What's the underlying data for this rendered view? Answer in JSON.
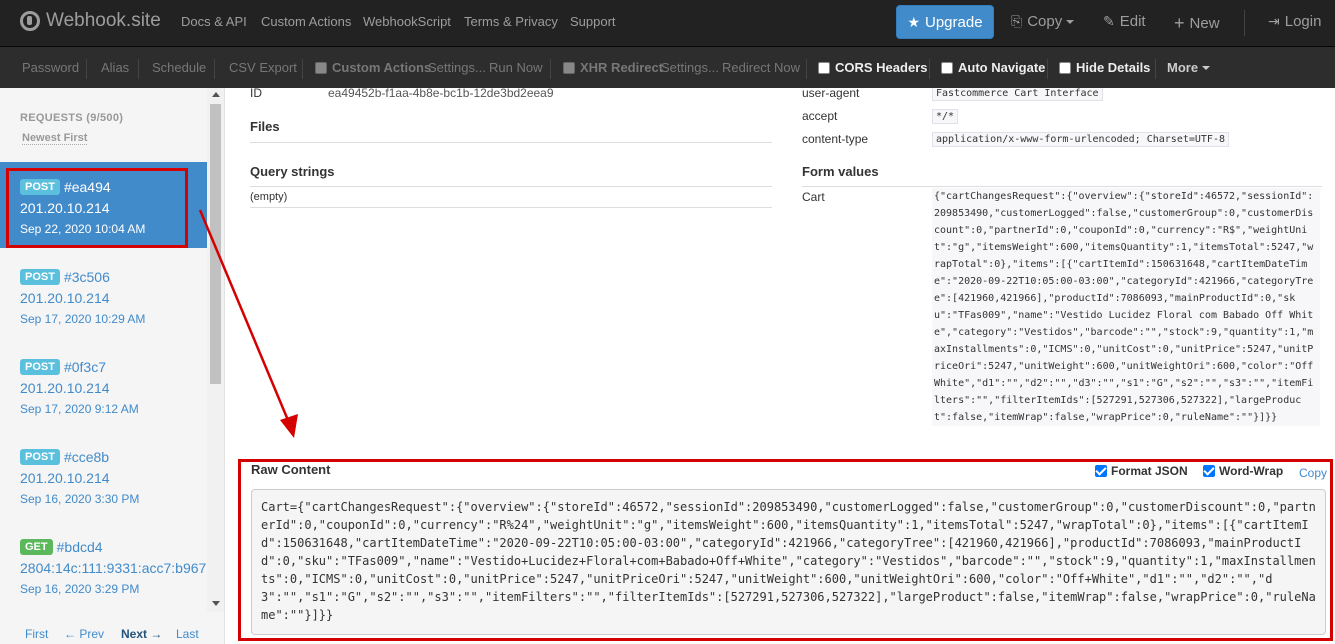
{
  "navbar": {
    "brand": "Webhook.site",
    "links": [
      "Docs & API",
      "Custom Actions",
      "WebhookScript",
      "Terms & Privacy",
      "Support"
    ],
    "upgrade": "Upgrade",
    "copy": "Copy",
    "edit": "Edit",
    "new": "New",
    "login": "Login"
  },
  "toolbar": {
    "password": "Password",
    "alias": "Alias",
    "schedule": "Schedule",
    "csv_export": "CSV Export",
    "custom_actions": "Custom Actions",
    "settings1": "Settings...",
    "run_now": "Run Now",
    "xhr_redirect": "XHR Redirect",
    "settings2": "Settings...",
    "redirect_now": "Redirect Now",
    "cors_headers": "CORS Headers",
    "auto_navigate": "Auto Navigate",
    "hide_details": "Hide Details",
    "more": "More"
  },
  "sidebar": {
    "header": "REQUESTS (9/500)",
    "sort": "Newest First",
    "items": [
      {
        "method": "POST",
        "id": "#ea494",
        "ip": "201.20.10.214",
        "date": "Sep 22, 2020 10:04 AM"
      },
      {
        "method": "POST",
        "id": "#3c506",
        "ip": "201.20.10.214",
        "date": "Sep 17, 2020 10:29 AM"
      },
      {
        "method": "POST",
        "id": "#0f3c7",
        "ip": "201.20.10.214",
        "date": "Sep 17, 2020 9:12 AM"
      },
      {
        "method": "POST",
        "id": "#cce8b",
        "ip": "201.20.10.214",
        "date": "Sep 16, 2020 3:30 PM"
      },
      {
        "method": "GET",
        "id": "#bdcd4",
        "ip": "2804:14c:111:9331:acc7:b967",
        "date": "Sep 16, 2020 3:29 PM"
      }
    ],
    "pager": {
      "first": "First",
      "prev": "← Prev",
      "next": "Next →",
      "last": "Last"
    }
  },
  "details": {
    "id_label": "ID",
    "id_value": "ea49452b-f1aa-4b8e-bc1b-12de3bd2eea9",
    "files_title": "Files",
    "query_title": "Query strings",
    "query_empty": "(empty)"
  },
  "headers": [
    {
      "key": "user-agent",
      "value": "Fastcommerce Cart Interface"
    },
    {
      "key": "accept",
      "value": "*/*"
    },
    {
      "key": "content-type",
      "value": "application/x-www-form-urlencoded; Charset=UTF-8"
    }
  ],
  "form": {
    "title": "Form values",
    "key": "Cart",
    "value": "{\"cartChangesRequest\":{\"overview\":{\"storeId\":46572,\"sessionId\":209853490,\"customerLogged\":false,\"customerGroup\":0,\"customerDiscount\":0,\"partnerId\":0,\"couponId\":0,\"currency\":\"R$\",\"weightUnit\":\"g\",\"itemsWeight\":600,\"itemsQuantity\":1,\"itemsTotal\":5247,\"wrapTotal\":0},\"items\":[{\"cartItemId\":150631648,\"cartItemDateTime\":\"2020-09-22T10:05:00-03:00\",\"categoryId\":421966,\"categoryTree\":[421960,421966],\"productId\":7086093,\"mainProductId\":0,\"sku\":\"TFas009\",\"name\":\"Vestido Lucidez Floral com Babado Off White\",\"category\":\"Vestidos\",\"barcode\":\"\",\"stock\":9,\"quantity\":1,\"maxInstallments\":0,\"ICMS\":0,\"unitCost\":0,\"unitPrice\":5247,\"unitPriceOri\":5247,\"unitWeight\":600,\"unitWeightOri\":600,\"color\":\"Off White\",\"d1\":\"\",\"d2\":\"\",\"d3\":\"\",\"s1\":\"G\",\"s2\":\"\",\"s3\":\"\",\"itemFilters\":\"\",\"filterItemIds\":[527291,527306,527322],\"largeProduct\":false,\"itemWrap\":false,\"wrapPrice\":0,\"ruleName\":\"\"}]}}"
  },
  "raw": {
    "title": "Raw Content",
    "format_json": "Format JSON",
    "word_wrap": "Word-Wrap",
    "copy": "Copy",
    "content": "Cart={\"cartChangesRequest\":{\"overview\":{\"storeId\":46572,\"sessionId\":209853490,\"customerLogged\":false,\"customerGroup\":0,\"customerDiscount\":0,\"partnerId\":0,\"couponId\":0,\"currency\":\"R%24\",\"weightUnit\":\"g\",\"itemsWeight\":600,\"itemsQuantity\":1,\"itemsTotal\":5247,\"wrapTotal\":0},\"items\":[{\"cartItemId\":150631648,\"cartItemDateTime\":\"2020-09-22T10:05:00-03:00\",\"categoryId\":421966,\"categoryTree\":[421960,421966],\"productId\":7086093,\"mainProductId\":0,\"sku\":\"TFas009\",\"name\":\"Vestido+Lucidez+Floral+com+Babado+Off+White\",\"category\":\"Vestidos\",\"barcode\":\"\",\"stock\":9,\"quantity\":1,\"maxInstallments\":0,\"ICMS\":0,\"unitCost\":0,\"unitPrice\":5247,\"unitPriceOri\":5247,\"unitWeight\":600,\"unitWeightOri\":600,\"color\":\"Off+White\",\"d1\":\"\",\"d2\":\"\",\"d3\":\"\",\"s1\":\"G\",\"s2\":\"\",\"s3\":\"\",\"itemFilters\":\"\",\"filterItemIds\":[527291,527306,527322],\"largeProduct\":false,\"itemWrap\":false,\"wrapPrice\":0,\"ruleName\":\"\"}]}}"
  },
  "colors": {
    "navbar": "#222222",
    "accent": "#428bca",
    "highlight": "#d50000"
  }
}
